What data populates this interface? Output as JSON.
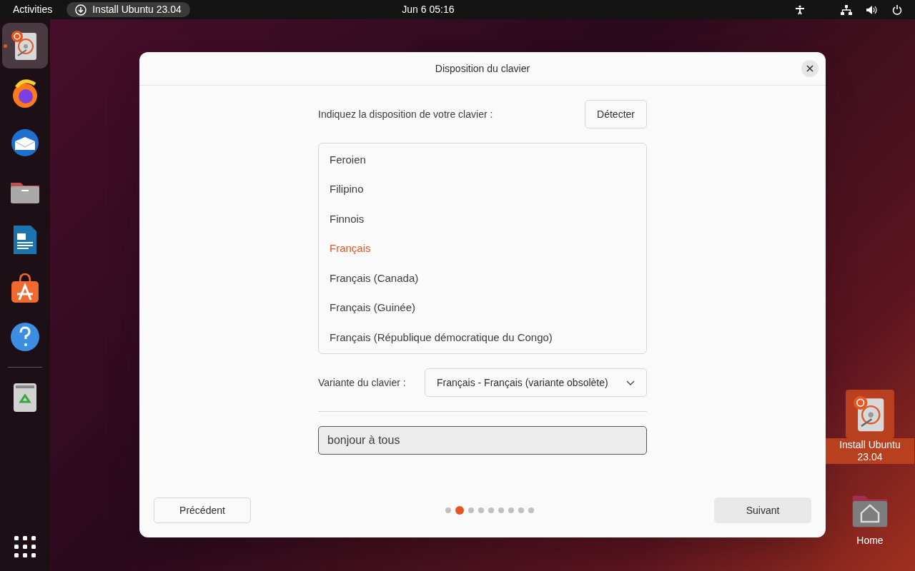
{
  "top_bar": {
    "activities": "Activities",
    "app_indicator": "Install Ubuntu 23.04",
    "clock": "Jun 6  05:16"
  },
  "dock": {
    "items": [
      {
        "kind": "installer",
        "running": true,
        "selected": true
      },
      {
        "kind": "browser",
        "running": false,
        "selected": false
      },
      {
        "kind": "mail",
        "running": false,
        "selected": false
      },
      {
        "kind": "files",
        "running": false,
        "selected": false
      },
      {
        "kind": "writer",
        "running": false,
        "selected": false
      },
      {
        "kind": "store",
        "running": false,
        "selected": false
      },
      {
        "kind": "help",
        "running": false,
        "selected": false
      },
      {
        "kind": "trash",
        "running": false,
        "selected": false
      }
    ]
  },
  "dialog": {
    "title": "Disposition du clavier",
    "prompt": "Indiquez la disposition de votre clavier :",
    "detect_button": "Détecter",
    "layouts": [
      {
        "label": "Feroien",
        "selected": false
      },
      {
        "label": "Filipino",
        "selected": false
      },
      {
        "label": "Finnois",
        "selected": false
      },
      {
        "label": "Français",
        "selected": true
      },
      {
        "label": "Français (Canada)",
        "selected": false
      },
      {
        "label": "Français (Guinée)",
        "selected": false
      },
      {
        "label": "Français (République démocratique du Congo)",
        "selected": false
      }
    ],
    "variant_label": "Variante du clavier :",
    "variant_value": "Français - Français (variante obsolète)",
    "test_field": {
      "value": "bonjour à tous"
    },
    "back_button": "Précédent",
    "next_button": "Suivant",
    "steps": [
      {
        "selected": false
      },
      {
        "selected": true
      },
      {
        "selected": false
      },
      {
        "selected": false
      },
      {
        "selected": false
      },
      {
        "selected": false
      },
      {
        "selected": false
      },
      {
        "selected": false
      },
      {
        "selected": false
      }
    ]
  },
  "desktop_icons": [
    {
      "kind": "installer",
      "label": "Install Ubuntu 23.04",
      "selected": true
    },
    {
      "kind": "home",
      "label": "Home",
      "selected": false
    }
  ]
}
